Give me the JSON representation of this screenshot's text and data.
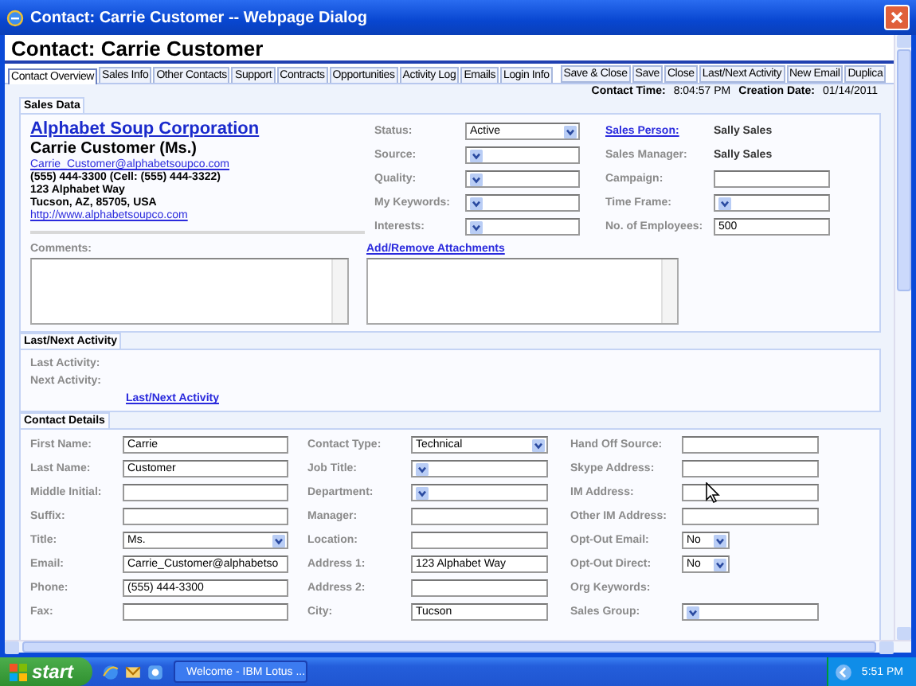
{
  "window": {
    "title": "Contact: Carrie Customer -- Webpage Dialog"
  },
  "heading": "Contact: Carrie Customer",
  "tabs": [
    {
      "label": "Contact Overview",
      "selected": true
    },
    {
      "label": "Sales Info",
      "selected": false
    },
    {
      "label": "Other Contacts",
      "selected": false
    },
    {
      "label": "Support",
      "selected": false
    },
    {
      "label": "Contracts",
      "selected": false
    },
    {
      "label": "Opportunities",
      "selected": false
    },
    {
      "label": "Activity Log",
      "selected": false
    },
    {
      "label": "Emails",
      "selected": false
    },
    {
      "label": "Login Info",
      "selected": false
    }
  ],
  "actions": [
    "Save & Close",
    "Save",
    "Close",
    "Last/Next Activity",
    "New Email",
    "Duplica"
  ],
  "meta": [
    {
      "label": "Contact Time:",
      "value": "8:04:57 PM"
    },
    {
      "label": "Creation Date:",
      "value": "01/14/2011"
    }
  ],
  "sales_data": {
    "title": "Sales Data",
    "company": "Alphabet Soup Corporation",
    "name": "Carrie Customer (Ms.)",
    "email": "Carrie_Customer@alphabetsoupco.com",
    "phone": "(555) 444-3300 (Cell: (555) 444-3322)",
    "address_lines": [
      "123 Alphabet Way",
      "Tucson, AZ, 85705, USA"
    ],
    "website": "http://www.alphabetsoupco.com",
    "fields": [
      {
        "label": "Status:",
        "kind": "select",
        "value": "Active"
      },
      {
        "label": "Source:",
        "kind": "select"
      },
      {
        "label": "Quality:",
        "kind": "select"
      },
      {
        "label": "My Keywords:",
        "kind": "select"
      },
      {
        "label": "Interests:",
        "kind": "select"
      }
    ],
    "fields_right": [
      {
        "label": "Sales Person:",
        "kind": "link",
        "value": "Sally Sales"
      },
      {
        "label": "Sales Manager:",
        "kind": "text",
        "value": "Sally Sales"
      },
      {
        "label": "Campaign:",
        "kind": "input"
      },
      {
        "label": "Time Frame:",
        "kind": "select"
      },
      {
        "label": "No. of Employees:",
        "kind": "input",
        "value": "500"
      }
    ],
    "comments_label": "Comments:",
    "attachments_link": "Add/Remove Attachments"
  },
  "activity": {
    "title": "Last/Next Activity",
    "rows": [
      "Last Activity:",
      "Next Activity:"
    ],
    "link": "Last/Next Activity"
  },
  "contact_details": {
    "title": "Contact Details",
    "columns": [
      [
        {
          "label": "First Name:",
          "kind": "input",
          "value": "Carrie"
        },
        {
          "label": "Last Name:",
          "kind": "input",
          "value": "Customer"
        },
        {
          "label": "Middle Initial:",
          "kind": "input"
        },
        {
          "label": "Suffix:",
          "kind": "input"
        },
        {
          "label": "Title:",
          "kind": "select",
          "value": "Ms."
        },
        {
          "label": "Email:",
          "kind": "input",
          "value": "Carrie_Customer@alphabetso"
        },
        {
          "label": "Phone:",
          "kind": "input",
          "value": "(555) 444-3300"
        },
        {
          "label": "Fax:",
          "kind": "input"
        }
      ],
      [
        {
          "label": "Contact Type:",
          "kind": "select",
          "value": "Technical"
        },
        {
          "label": "Job Title:",
          "kind": "select"
        },
        {
          "label": "Department:",
          "kind": "select"
        },
        {
          "label": "Manager:",
          "kind": "input"
        },
        {
          "label": "Location:",
          "kind": "input"
        },
        {
          "label": "Address 1:",
          "kind": "input",
          "value": "123 Alphabet Way"
        },
        {
          "label": "Address 2:",
          "kind": "input"
        },
        {
          "label": "City:",
          "kind": "input",
          "value": "Tucson"
        }
      ],
      [
        {
          "label": "Hand Off Source:",
          "kind": "input"
        },
        {
          "label": "Skype Address:",
          "kind": "input"
        },
        {
          "label": "IM Address:",
          "kind": "input"
        },
        {
          "label": "Other IM Address:",
          "kind": "input"
        },
        {
          "label": "Opt-Out Email:",
          "kind": "small_select",
          "value": "No"
        },
        {
          "label": "Opt-Out Direct:",
          "kind": "small_select",
          "value": "No"
        },
        {
          "label": "Org Keywords:",
          "kind": "none"
        },
        {
          "label": "Sales Group:",
          "kind": "select"
        }
      ]
    ]
  },
  "taskbar": {
    "start": "start",
    "tasks": [
      "Welcome - IBM Lotus ..."
    ],
    "clock": "5:51 PM"
  }
}
